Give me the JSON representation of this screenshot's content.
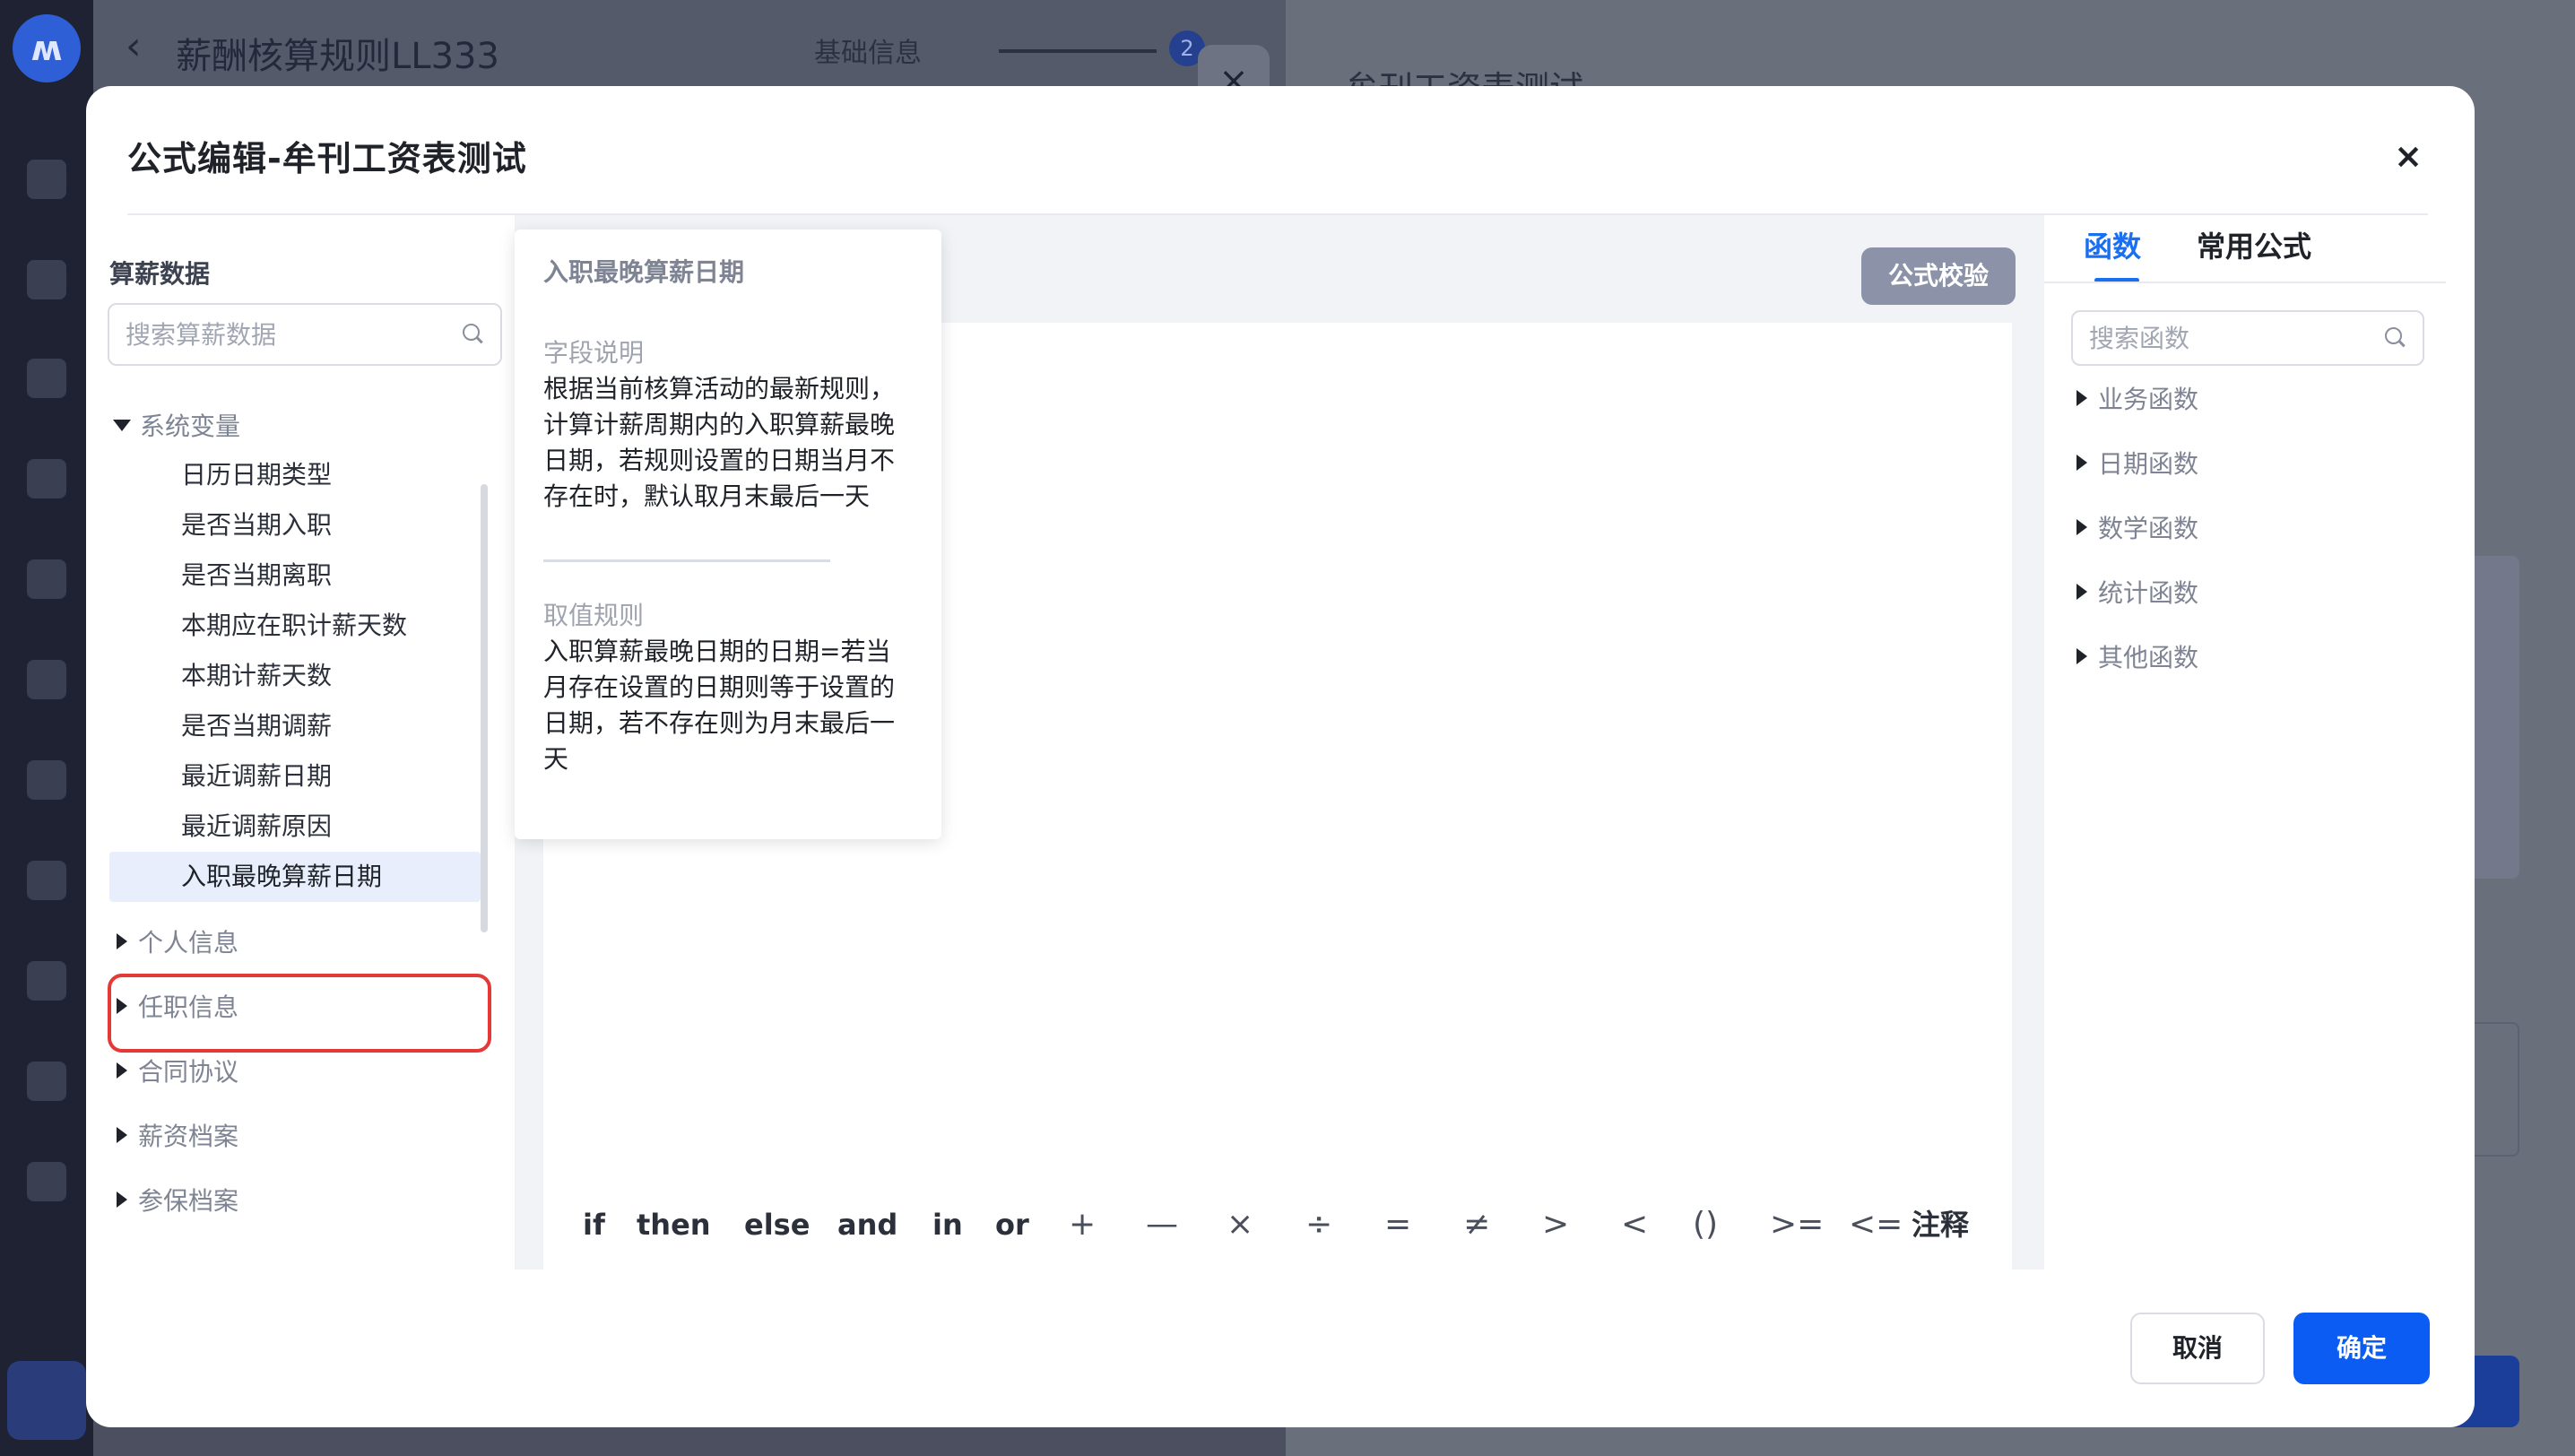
{
  "background": {
    "page_title": "薪酬核算规则LL333",
    "step1_label": "基础信息",
    "step2_number": "2",
    "drawer_title": "牟刊工资表测试"
  },
  "modal": {
    "title": "公式编辑-牟刊工资表测试",
    "close_label": "×"
  },
  "left_panel": {
    "heading": "算薪数据",
    "search_placeholder": "搜索算薪数据",
    "open_group": "系统变量",
    "items": [
      "日历日期类型",
      "是否当期入职",
      "是否当期离职",
      "本期应在职计薪天数",
      "本期计薪天数",
      "是否当期调薪",
      "最近调薪日期",
      "最近调薪原因",
      "入职最晚算薪日期"
    ],
    "selected_index": 8,
    "groups": [
      "个人信息",
      "任职信息",
      "合同协议",
      "薪资档案",
      "参保档案"
    ]
  },
  "tooltip": {
    "title": "入职最晚算薪日期",
    "desc_label": "字段说明",
    "desc_text": "根据当前核算活动的最新规则，计算计薪周期内的入职算薪最晚日期，若规则设置的日期当月不存在时，默认取月末最后一天",
    "rule_label": "取值规则",
    "rule_text": "入职算薪最晚日期的日期=若当月存在设置的日期则等于设置的日期，若不存在则为月末最后一天"
  },
  "editor": {
    "validate_label": "公式校验",
    "operators": [
      "if",
      "then",
      "else",
      "and",
      "in",
      "or",
      "+",
      "—",
      "×",
      "÷",
      "=",
      "≠",
      ">",
      "<",
      "()",
      ">=",
      "<=",
      "注释"
    ]
  },
  "right_panel": {
    "tabs": [
      "函数",
      "常用公式"
    ],
    "active_tab": "函数",
    "search_placeholder": "搜索函数",
    "groups": [
      "业务函数",
      "日期函数",
      "数学函数",
      "统计函数",
      "其他函数"
    ]
  },
  "footer": {
    "cancel_label": "取消",
    "ok_label": "确定"
  },
  "colors": {
    "accent": "#0b5cf2",
    "tab_active": "#1a6ef0",
    "highlight_outline": "#e53935",
    "validate_button": "#8c93a8"
  }
}
